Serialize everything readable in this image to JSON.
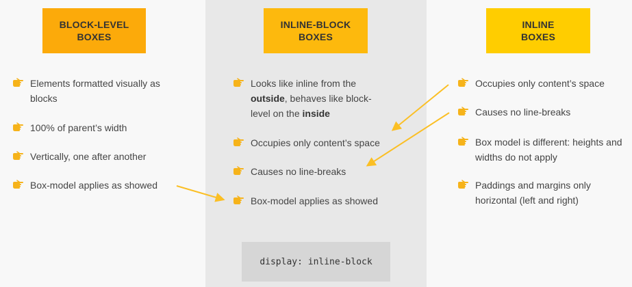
{
  "columns": {
    "block": {
      "title": "BLOCK-LEVEL\nBOXES",
      "items": [
        "Elements formatted visually as blocks",
        "100% of parent’s width",
        "Vertically, one after another",
        "Box-model applies as showed"
      ]
    },
    "inline_block": {
      "title": "INLINE-BLOCK\nBOXES",
      "item1": {
        "p1": "Looks like inline from the ",
        "b1": "outside",
        "p2": ", behaves like block-level on the ",
        "b2": "inside"
      },
      "items": [
        "Occupies only content’s space",
        "Causes no line-breaks",
        "Box-model applies as showed"
      ],
      "code": "display: inline-block"
    },
    "inline": {
      "title": "INLINE\nBOXES",
      "items": [
        "Occupies only content’s space",
        "Causes no line-breaks",
        "Box model is different: heights and widths do not apply",
        "Paddings and margins only horizontal (left and right)"
      ]
    }
  },
  "colors": {
    "header_left": "#fcaa0a",
    "header_mid": "#fdb90d",
    "header_right": "#ffcd00",
    "arrow": "#fbbf24",
    "hand": "#f6b31a"
  },
  "icons": {
    "bullet": "pointing-hand-icon",
    "connector": "arrow"
  }
}
